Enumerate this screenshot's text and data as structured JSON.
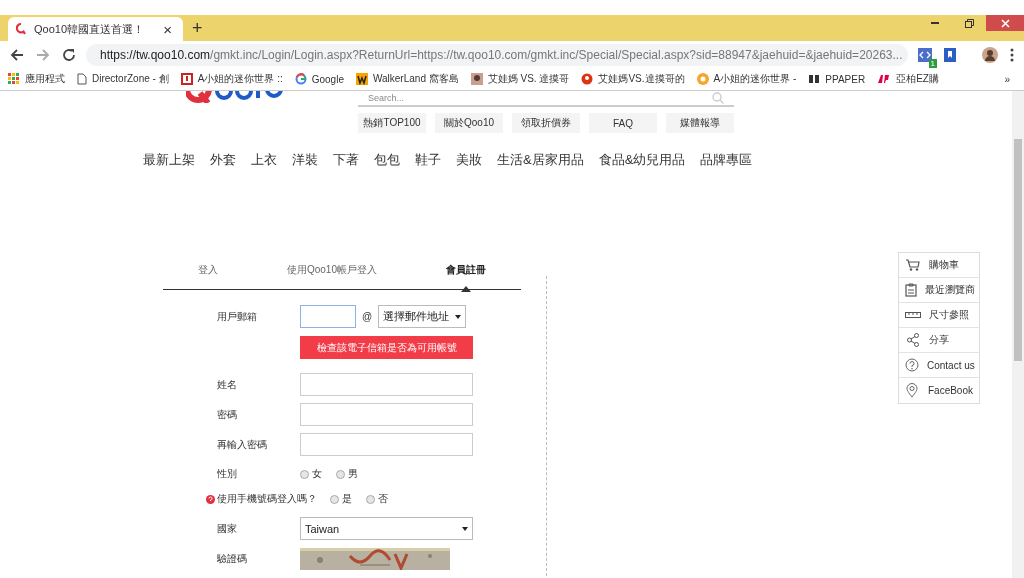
{
  "browser": {
    "tab_title": "Qoo10韓國直送首選！",
    "tab_close": "×",
    "new_tab": "+",
    "url_host": "https://tw.qoo10.com",
    "url_path": "/gmkt.inc/Login/Login.aspx?ReturnUrl=https://tw.qoo10.com/gmkt.inc/Special/Special.aspx?sid=88947&jaehuid=&jaehuid=20263...",
    "extension_badge": "1",
    "more_bookmarks": "»"
  },
  "bookmarks": [
    {
      "label": "應用程式"
    },
    {
      "label": "DirectorZone - 創"
    },
    {
      "label": "A小姐的迷你世界 ::"
    },
    {
      "label": "Google"
    },
    {
      "label": "WalkerLand 窩客島"
    },
    {
      "label": "艾娃媽 VS. 達摸哥"
    },
    {
      "label": "艾娃媽VS.達摸哥的"
    },
    {
      "label": "A小姐的迷你世界 -"
    },
    {
      "label": "PPAPER"
    },
    {
      "label": "亞柏EZ購"
    }
  ],
  "header": {
    "search_placeholder": "Search...",
    "links": [
      "熱銷TOP100",
      "關於Qoo10",
      "領取折價券",
      "FAQ",
      "媒體報導"
    ]
  },
  "categories": [
    "最新上架",
    "外套",
    "上衣",
    "洋裝",
    "下著",
    "包包",
    "鞋子",
    "美妝",
    "生活&居家用品",
    "食品&幼兒用品",
    "品牌專區"
  ],
  "login_tabs": [
    {
      "label": "登入",
      "selected": false
    },
    {
      "label": "使用Qoo10帳戶登入",
      "selected": false
    },
    {
      "label": "會員註冊",
      "selected": true
    }
  ],
  "form": [
    {
      "kind": "email",
      "label": "用戶郵箱",
      "at": "@",
      "domain_select": "選擇郵件地址",
      "check_button": "檢查該電子信箱是否為可用帳號"
    },
    {
      "kind": "text",
      "label": "姓名"
    },
    {
      "kind": "text",
      "label": "密碼"
    },
    {
      "kind": "text",
      "label": "再輸入密碼"
    },
    {
      "kind": "radio",
      "label": "性別",
      "help": false,
      "options": [
        {
          "label": "女",
          "selected": false
        },
        {
          "label": "男",
          "selected": false
        }
      ]
    },
    {
      "kind": "radio",
      "label": "使用手機號碼登入嗎？",
      "help": true,
      "options": [
        {
          "label": "是",
          "selected": false
        },
        {
          "label": "否",
          "selected": false
        }
      ]
    },
    {
      "kind": "select",
      "label": "國家",
      "value": "Taiwan"
    },
    {
      "kind": "captcha",
      "label": "驗證碼"
    }
  ],
  "side_menu": [
    {
      "label": "購物車"
    },
    {
      "label": "最近瀏覽商"
    },
    {
      "label": "尺寸參照"
    },
    {
      "label": "分享"
    },
    {
      "label": "Contact us"
    },
    {
      "label": "FaceBook"
    }
  ]
}
